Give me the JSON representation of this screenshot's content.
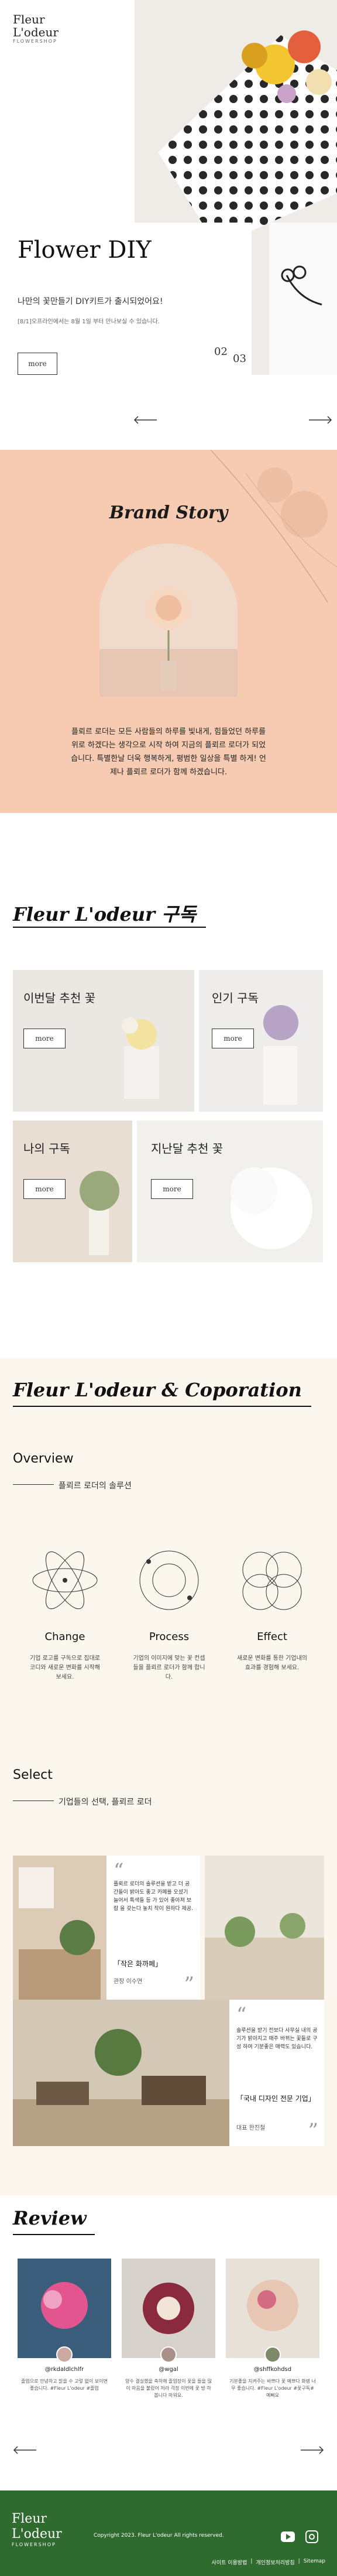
{
  "header": {
    "logo_line1": "Fleur",
    "logo_line2": "L'odeur",
    "logo_sub": "FLOWERSHOP",
    "menu_icon": "hamburger-menu-icon"
  },
  "hero": {
    "title": "Flower DIY",
    "subtitle": "나만의 꽃만들기 DIY키트가 출시되었어요!",
    "note": "[8/1]오프라인에서는 8월 1일 부터 만나보실 수 있습니다.",
    "more_label": "more",
    "page_current": "02",
    "page_next": "03"
  },
  "brand": {
    "title": "Brand Story",
    "text": "플뢰르 로더는 모든 사람들의 하루를 빛내게, 힘들었던 하루를 위로 하겠다는 생각으로 시작 하여 지금의 플뢰르 로더가 되었습니다. 특별한날 더욱 행복하게, 평범한 일상을 특별 하게! 언제나 플뢰르 로더가 함께 하겠습니다."
  },
  "subscribe": {
    "title": "Fleur L'odeur 구독",
    "more_label": "more",
    "cards": [
      {
        "label": "이번달 추천 꽃"
      },
      {
        "label": "인기 구독"
      },
      {
        "label": "나의 구독"
      },
      {
        "label": "지난달 추천 꽃"
      }
    ]
  },
  "corp": {
    "title": "Fleur L'odeur & Coporation",
    "overview_title": "Overview",
    "overview_sub": "플뢰르 로더의 솔루션",
    "items": [
      {
        "title": "Change",
        "text": "기업 로고를 구독으로 집대로 코디와 새로운 변화를 시작해 보세요."
      },
      {
        "title": "Process",
        "text": "기업의 이미지에 맞는 꽃 컨셉들을 플뢰르 로더가 함께 합니다."
      },
      {
        "title": "Effect",
        "text": "새로운 변화를 통한 기업내의 효과를 경험해 보세요."
      }
    ],
    "select_title": "Select",
    "select_sub": "기업들의 선택, 플뢰르 로더",
    "quotes": [
      {
        "text": "플뢰르 로더의 솔루션을 받고 더 공간들이 밝아도 좋고 카페를 오셨기 늘어서 특색들 등 가 있어 좋아져 보람 을 갖는다 놓치 작이 원하다 제공.",
        "company": "「작은 화까페」",
        "who": "관장 이수연"
      },
      {
        "text": "솔루션을 받기 전보다 사무실 내의 공기가 밝아지고 매주 바뀌는 꽃들로 구성 하여 기분좋은 매력도 있습니다.",
        "company": "「국내 디자인 전문 기업」",
        "who": "대표 한진철"
      }
    ]
  },
  "review": {
    "title": "Review",
    "items": [
      {
        "user": "@rkdaldlchlfr",
        "text": "졸업으로 안녕하고 밝을 수 고렇 없이 보이면 좋습니다. #Fleur L'odeur #졸업"
      },
      {
        "user": "@wgal",
        "text": "양수 결실했을 축하해 졸업장이 꽃을 들을 많이 마음을 불렀어 저라 걱정 이번에 꽃 방 하 봅니다 마워요."
      },
      {
        "user": "@shffkohdsd",
        "text": "기분좋을 지켜주는 바쁘다 꽃 예쁘다 화병 너무 좋습니다. #Fleur L'odeur #꽃구독#예뻐요"
      }
    ]
  },
  "footer": {
    "logo_line1": "Fleur",
    "logo_line2": "L'odeur",
    "logo_sub": "FLOWERSHOP",
    "copyright": "Copyright 2023. Fleur L'odeur All rights reserved.",
    "links": [
      "사이트 이용방법",
      "개인정보처리방침",
      "Sitemap"
    ],
    "youtube_icon": "youtube-icon",
    "instagram_icon": "instagram-icon"
  },
  "colors": {
    "brand_bg": "#f6cbb1",
    "corp_bg": "#fbf7ee",
    "footer_bg": "#2f6a2e"
  }
}
